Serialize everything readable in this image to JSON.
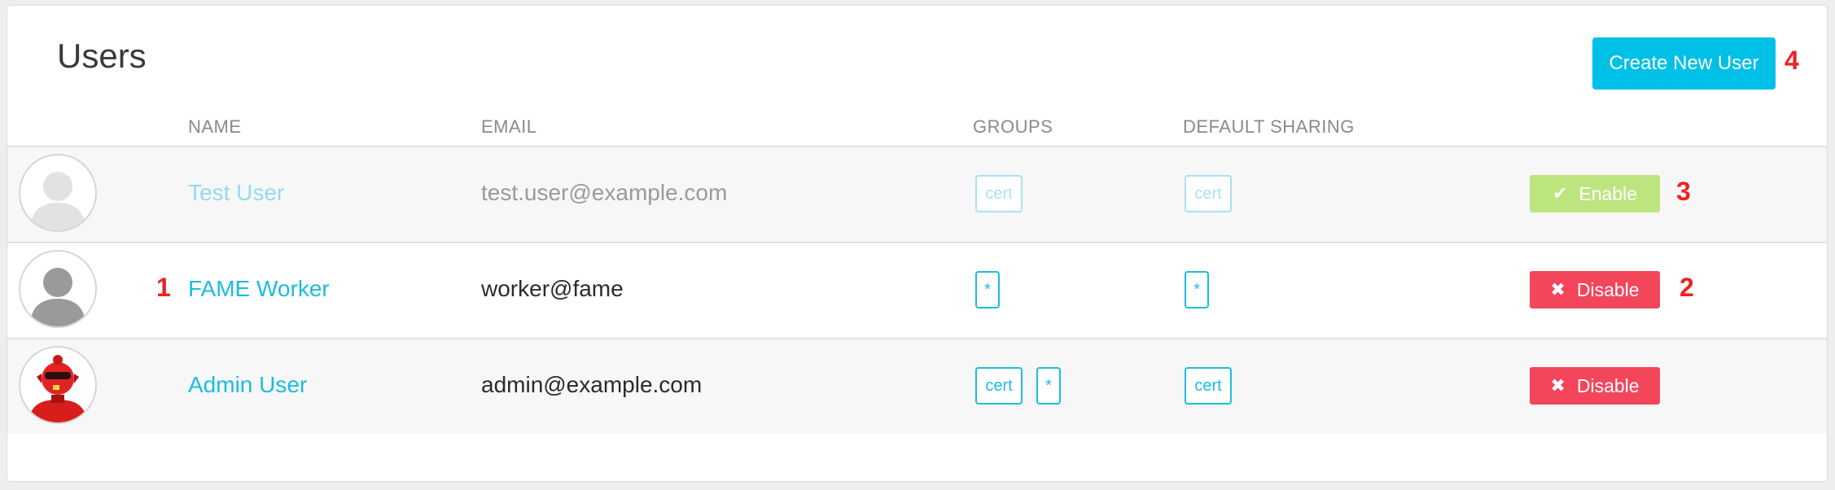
{
  "page": {
    "title": "Users"
  },
  "toolbar": {
    "create_label": "Create New User"
  },
  "columns": {
    "name": "NAME",
    "email": "EMAIL",
    "groups": "GROUPS",
    "default_sharing": "DEFAULT SHARING"
  },
  "users": [
    {
      "name": "Test User",
      "email": "test.user@example.com",
      "groups": [
        "cert"
      ],
      "sharing": [
        "cert"
      ],
      "action": "Enable",
      "action_icon": "check-icon",
      "status": "disabled",
      "avatar": "placeholder-silhouette"
    },
    {
      "name": "FAME Worker",
      "email": "worker@fame",
      "groups": [
        "*"
      ],
      "sharing": [
        "*"
      ],
      "action": "Disable",
      "action_icon": "x-icon",
      "status": "enabled",
      "avatar": "placeholder-silhouette"
    },
    {
      "name": "Admin User",
      "email": "admin@example.com",
      "groups": [
        "cert",
        "*"
      ],
      "sharing": [
        "cert"
      ],
      "action": "Disable",
      "action_icon": "x-icon",
      "status": "enabled",
      "avatar": "red-robot"
    }
  ],
  "markers": {
    "m1": "1",
    "m2": "2",
    "m3": "3",
    "m4": "4"
  },
  "colors": {
    "accent": "#00c0e8",
    "enable": "#bde57f",
    "disable": "#f3465b",
    "marker": "#ee2222"
  }
}
